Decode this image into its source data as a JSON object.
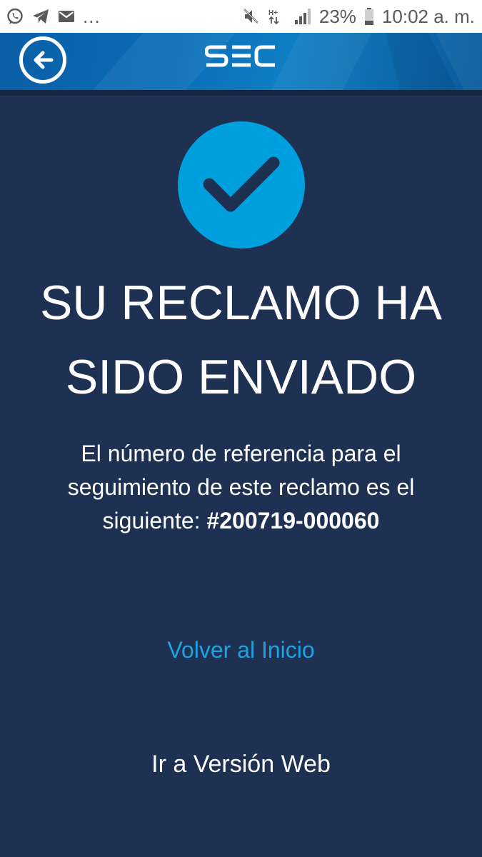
{
  "status_bar": {
    "icons_left": [
      "whatsapp-icon",
      "telegram-icon",
      "mail-icon"
    ],
    "more": "...",
    "icons_right": [
      "mute-icon",
      "network-hplus-icon",
      "signal-icon"
    ],
    "battery_percent": "23%",
    "time": "10:02 a. m."
  },
  "header": {
    "back_icon": "arrow-left-icon",
    "logo_text": "SEC"
  },
  "main": {
    "success_icon": "checkmark-icon",
    "title_line1": "SU RECLAMO HA",
    "title_line2": "SIDO ENVIADO",
    "message_text": "El número de referencia para el seguimiento de este reclamo es el siguiente: ",
    "reference_number": "#200719-000060",
    "home_link": "Volver al Inicio",
    "web_link": "Ir a Versión Web"
  },
  "colors": {
    "background": "#1e3153",
    "accent": "#009fde",
    "link": "#1da4e0",
    "header": "#0a6cb7"
  }
}
